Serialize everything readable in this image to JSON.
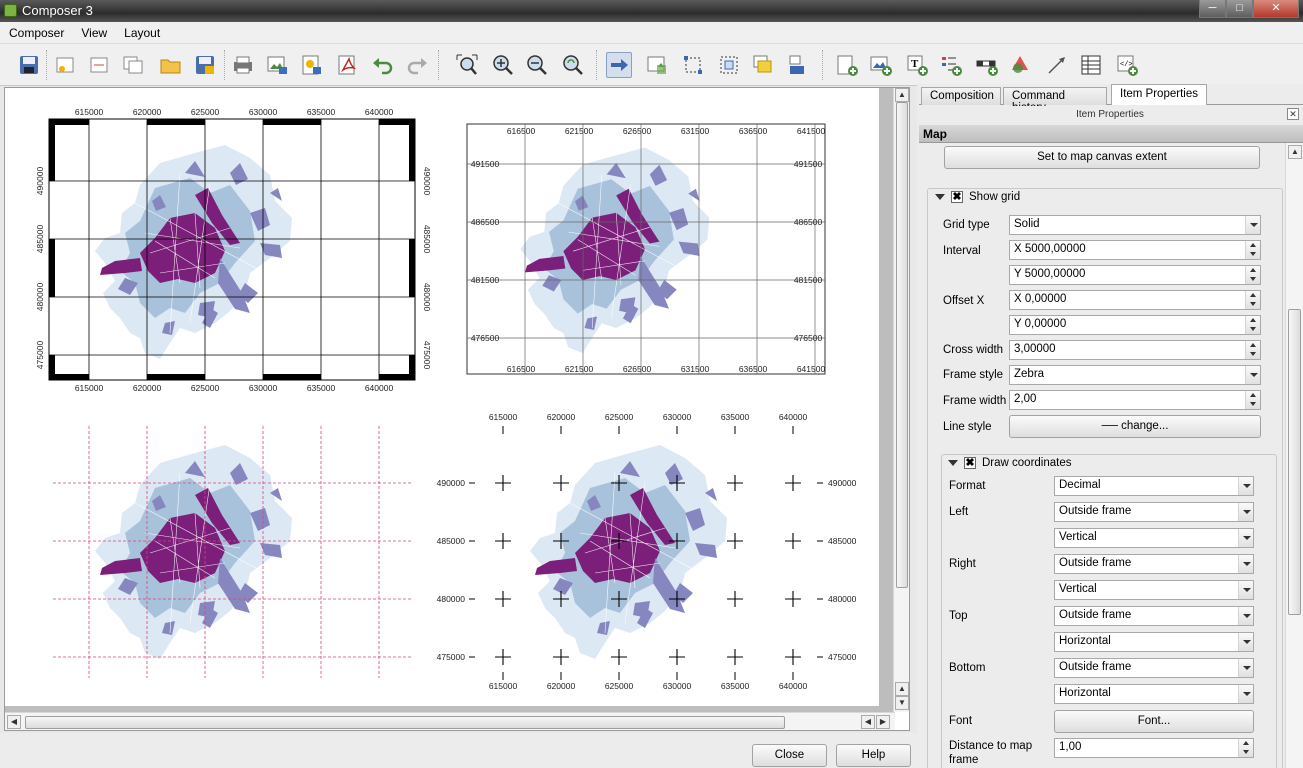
{
  "window": {
    "title": "Composer 3",
    "min": "─",
    "max": "□",
    "close": "✕"
  },
  "menu": [
    "Composer",
    "View",
    "Layout"
  ],
  "toolbar": {
    "icons": [
      "save-icon",
      "new-composer-icon",
      "add-page-icon",
      "duplicate-icon",
      "open-template-icon",
      "save-template-icon",
      "print-icon",
      "export-image-icon",
      "export-svg-icon",
      "export-pdf-icon",
      "undo-icon",
      "redo-icon",
      "zoom-full-icon",
      "zoom-in-icon",
      "zoom-out-icon",
      "refresh-icon",
      "select-move-icon",
      "move-content-icon",
      "edit-nodes-icon",
      "group-icon",
      "raise-icon",
      "align-icon",
      "add-map-icon",
      "add-image-icon",
      "add-label-icon",
      "add-legend-icon",
      "add-scalebar-icon",
      "add-shape-icon",
      "add-arrow-icon",
      "add-table-icon",
      "add-html-icon"
    ]
  },
  "maps": {
    "map1": {
      "x_labels": [
        "615000",
        "620000",
        "625000",
        "630000",
        "635000",
        "640000"
      ],
      "y_labels": [
        "490000",
        "485000",
        "480000",
        "475000"
      ]
    },
    "map2": {
      "x_labels": [
        "616500",
        "621500",
        "626500",
        "631500",
        "636500",
        "641500"
      ],
      "y_labels": [
        "491500",
        "486500",
        "481500",
        "476500"
      ]
    },
    "map4": {
      "x_labels": [
        "615000",
        "620000",
        "625000",
        "630000",
        "635000",
        "640000"
      ],
      "y_labels": [
        "490000",
        "485000",
        "480000",
        "475000"
      ]
    }
  },
  "dock": {
    "tabs": [
      "Composition",
      "Command history",
      "Item Properties"
    ],
    "header": "Item Properties",
    "close": "✕",
    "section": "Map",
    "set_extent_button": "Set to map canvas extent",
    "show_grid": {
      "label": "Show grid",
      "checked": "✖"
    },
    "grid_type": {
      "label": "Grid type",
      "value": "Solid"
    },
    "interval": {
      "label": "Interval",
      "x": "X 5000,00000",
      "y": "Y 5000,00000"
    },
    "offset": {
      "label": "Offset X",
      "x": "X 0,00000",
      "y": "Y 0,00000"
    },
    "cross_width": {
      "label": "Cross width",
      "value": "3,00000"
    },
    "frame_style": {
      "label": "Frame style",
      "value": "Zebra"
    },
    "frame_width": {
      "label": "Frame width",
      "value": "2,00"
    },
    "line_style": {
      "label": "Line style",
      "button": "── change..."
    },
    "draw_coords": {
      "label": "Draw coordinates",
      "checked": "✖"
    },
    "format": {
      "label": "Format",
      "value": "Decimal"
    },
    "left": {
      "label": "Left",
      "pos": "Outside frame",
      "dir": "Vertical"
    },
    "right": {
      "label": "Right",
      "pos": "Outside frame",
      "dir": "Vertical"
    },
    "top": {
      "label": "Top",
      "pos": "Outside frame",
      "dir": "Horizontal"
    },
    "bottom": {
      "label": "Bottom",
      "pos": "Outside frame",
      "dir": "Horizontal"
    },
    "font": {
      "label": "Font",
      "button": "Font..."
    },
    "distance": {
      "label": "Distance to map frame",
      "value": "1,00"
    }
  },
  "buttons": {
    "close": "Close",
    "help": "Help"
  },
  "colors": {
    "dark": "#7b1f7a",
    "mid": "#8787c0",
    "light": "#a9c2dc",
    "pale": "#dce8f4",
    "grid_pink": "#d9447a"
  }
}
